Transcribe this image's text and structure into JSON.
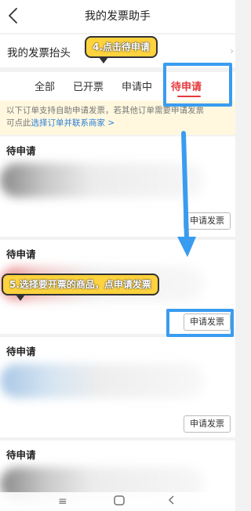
{
  "nav": {
    "title": "我的发票助手"
  },
  "header": {
    "label": "我的发票抬头",
    "chevron": "›"
  },
  "tabs": [
    {
      "label": "全部"
    },
    {
      "label": "已开票"
    },
    {
      "label": "申请中"
    },
    {
      "label": "待申请"
    }
  ],
  "active_tab": "待申请",
  "notice": {
    "text_line1": "以下订单支持自助申请发票，若其他订单需要申请发票",
    "text_line2": "可点此",
    "link_text": "选择订单并联系商家",
    "link_arrow": ">"
  },
  "orders": [
    {
      "status": "待申请",
      "button": "申请发票"
    },
    {
      "status": "待申请",
      "button": "申请发票"
    },
    {
      "status": "待申请",
      "button": "申请发票"
    },
    {
      "status": "待申请"
    }
  ],
  "annotations": {
    "step4": "4.点击待申请",
    "step5": "5.选择要开票的商品，点申请发票",
    "highlight_color": "#3a9cf0",
    "callout_color": "#ffd33d"
  },
  "bottom_nav": {
    "menu_icon": "≡"
  },
  "colors": {
    "accent": "#e4393c",
    "link": "#2d7fd6",
    "notice_bg": "#fff8df"
  }
}
